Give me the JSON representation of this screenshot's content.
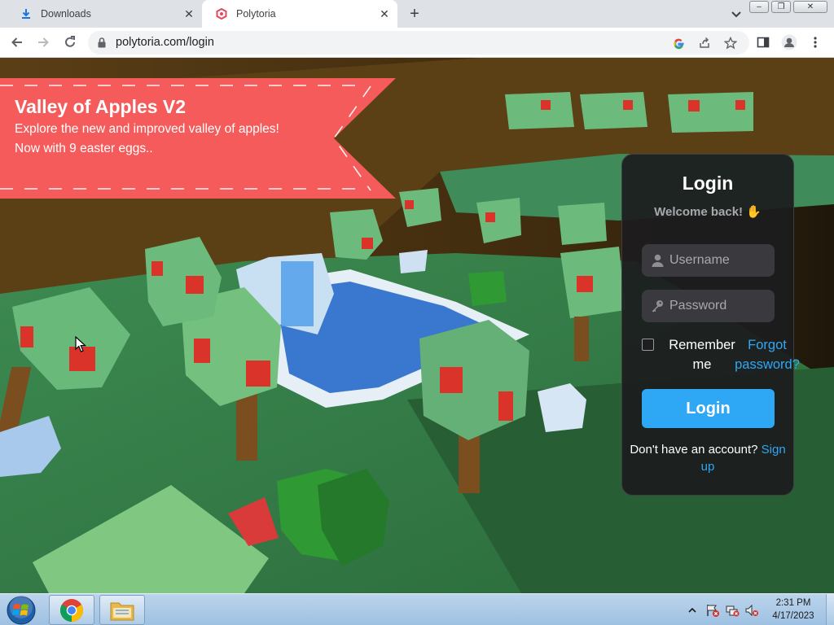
{
  "browser": {
    "tabs": [
      {
        "label": "Downloads",
        "icon": "download-icon",
        "active": false
      },
      {
        "label": "Polytoria",
        "icon": "polytoria-favicon-icon",
        "active": true
      }
    ],
    "url": "polytoria.com/login"
  },
  "banner": {
    "title": "Valley of Apples V2",
    "description": "Explore the new and improved valley of apples! Now with 9 easter eggs..",
    "color": "#f55b5b"
  },
  "login": {
    "title": "Login",
    "subtitle": "Welcome back! ✋",
    "username_placeholder": "Username",
    "password_placeholder": "Password",
    "remember_label": "Remember me",
    "forgot_label": "Forgot password?",
    "submit_label": "Login",
    "signup_prompt": "Don't have an account?",
    "signup_link": "Sign up",
    "accent_color": "#2ea8f5"
  },
  "taskbar": {
    "time": "2:31 PM",
    "date": "4/17/2023"
  }
}
